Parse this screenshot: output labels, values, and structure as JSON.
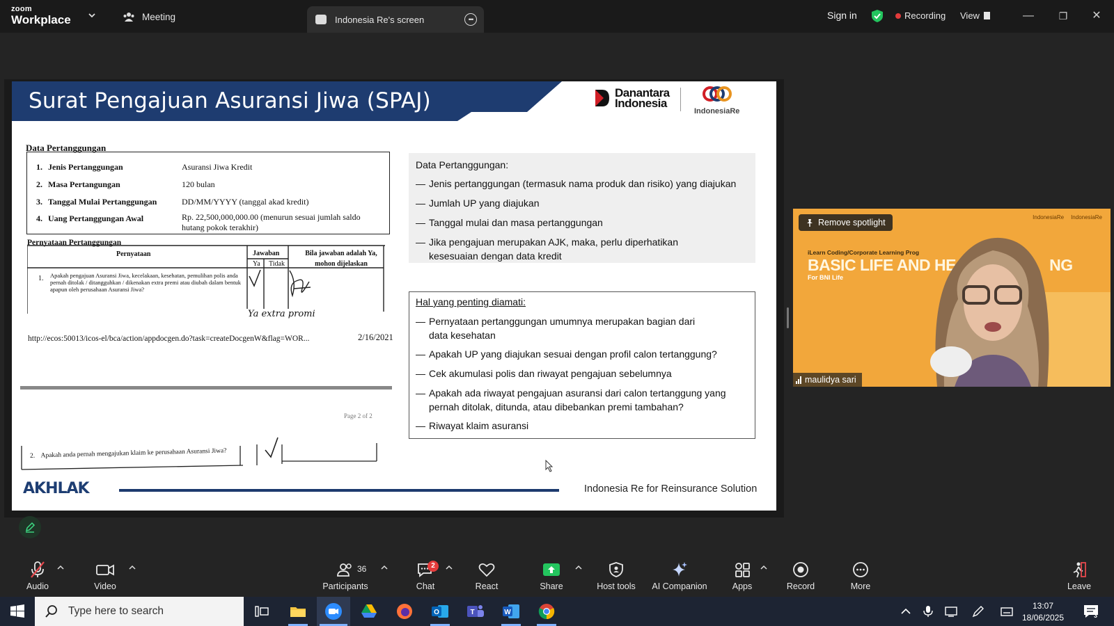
{
  "app": {
    "brand_small": "zoom",
    "brand_big": "Workplace"
  },
  "tabs": {
    "meeting_label": "Meeting",
    "share_label": "Indonesia Re's screen"
  },
  "topbar": {
    "signin_label": "Sign in",
    "recording_label": "Recording",
    "view_label": "View"
  },
  "slide": {
    "title": "Surat Pengajuan Asuransi Jiwa (SPAJ)",
    "logo_left": [
      "Danantara",
      "Indonesia"
    ],
    "logo_right": "IndonesiaRe",
    "doc": {
      "section1": "Data Pertanggungan",
      "rows": [
        {
          "num": "1.",
          "label": "Jenis Pertanggungan",
          "value": "Asuransi Jiwa Kredit"
        },
        {
          "num": "2.",
          "label": "Masa Pertangungan",
          "value": "120 bulan"
        },
        {
          "num": "3.",
          "label": "Tanggal Mulai Pertanggungan",
          "value": "DD/MM/YYYY (tanggal akad kredit)"
        },
        {
          "num": "4.",
          "label": "Uang Pertanggungan Awal",
          "value": "Rp. 22,500,000,000.00 (menurun sesuai jumlah saldo hutang pokok terakhir)"
        }
      ],
      "section2": "Pernyataan Pertanggungan",
      "col_pernyataan": "Pernyataan",
      "col_jawaban": "Jawaban",
      "col_ya": "Ya",
      "col_tidak": "Tidak",
      "col_bila": "Bila jawaban adalah Ya, mohon dijelaskan",
      "q1_num": "1.",
      "q1_text": "Apakah pengajuan Asuransi Jiwa, kecelakaan, kesehatan, pemulihan polis anda pernah ditolak / ditangguhkan / dikenakan extra premi atau diubah dalam bentuk apapun oleh perusahaan Asuransi Jiwa?",
      "handwritten": "Ya extra promi",
      "url": "http://ecos:50013/icos-el/bca/action/appdocgen.do?task=createDocgenW&flag=WOR...",
      "date": "2/16/2021",
      "page": "Page 2 of 2",
      "q2_num": "2.",
      "q2_text": "Apakah anda pernah mengajukan klaim ke perusahaan Asuransi Jiwa?"
    },
    "panel1": {
      "heading": "Data Pertanggungan:",
      "items": [
        "Jenis pertanggungan (termasuk nama produk dan risiko) yang diajukan",
        "Jumlah UP yang diajukan",
        "Tanggal mulai dan masa pertanggungan",
        "Jika pengajuan merupakan AJK, maka, perlu diperhatikan kesesuaian dengan data kredit"
      ]
    },
    "panel2": {
      "heading": "Hal yang penting diamati:",
      "items": [
        "Pernyataan pertanggungan umumnya merupakan bagian dari data kesehatan",
        "Apakah UP yang diajukan sesuai dengan profil calon tertanggung?",
        "Cek akumulasi polis dan riwayat pengajuan sebelumnya",
        "Apakah ada riwayat pengajuan asuransi dari calon tertanggung yang pernah ditolak, ditunda, atau dibebankan premi tambahan?",
        "Riwayat klaim asuransi"
      ]
    },
    "dash": "—",
    "footer_brand": "AKHLAK",
    "footer_text": "Indonesia Re for Reinsurance Solution"
  },
  "video": {
    "spotlight_label": "Remove spotlight",
    "participant_name": "maulidya sari",
    "bg_course": "iLearn Coding/Corporate Learning Prog",
    "bg_title": "BASIC LIFE AND HEA",
    "bg_title_end": "NG",
    "bg_sub": "For BNI Life",
    "bg_logos": [
      "IndonesiaRe",
      "IndonesiaRe"
    ]
  },
  "toolbar": {
    "audio": "Audio",
    "video": "Video",
    "participants": "Participants",
    "participants_count": "36",
    "chat": "Chat",
    "chat_badge": "2",
    "react": "React",
    "share": "Share",
    "host_tools": "Host tools",
    "ai_companion": "AI Companion",
    "apps": "Apps",
    "record": "Record",
    "more": "More",
    "leave": "Leave"
  },
  "taskbar": {
    "search_placeholder": "Type here to search",
    "time": "13:07",
    "date": "18/06/2025",
    "notif_count": "3"
  },
  "colors": {
    "slide_header": "#1e3c70",
    "accent_green": "#23c55e",
    "recording_red": "#e23b3b",
    "video_bg": "#f2a73b"
  }
}
